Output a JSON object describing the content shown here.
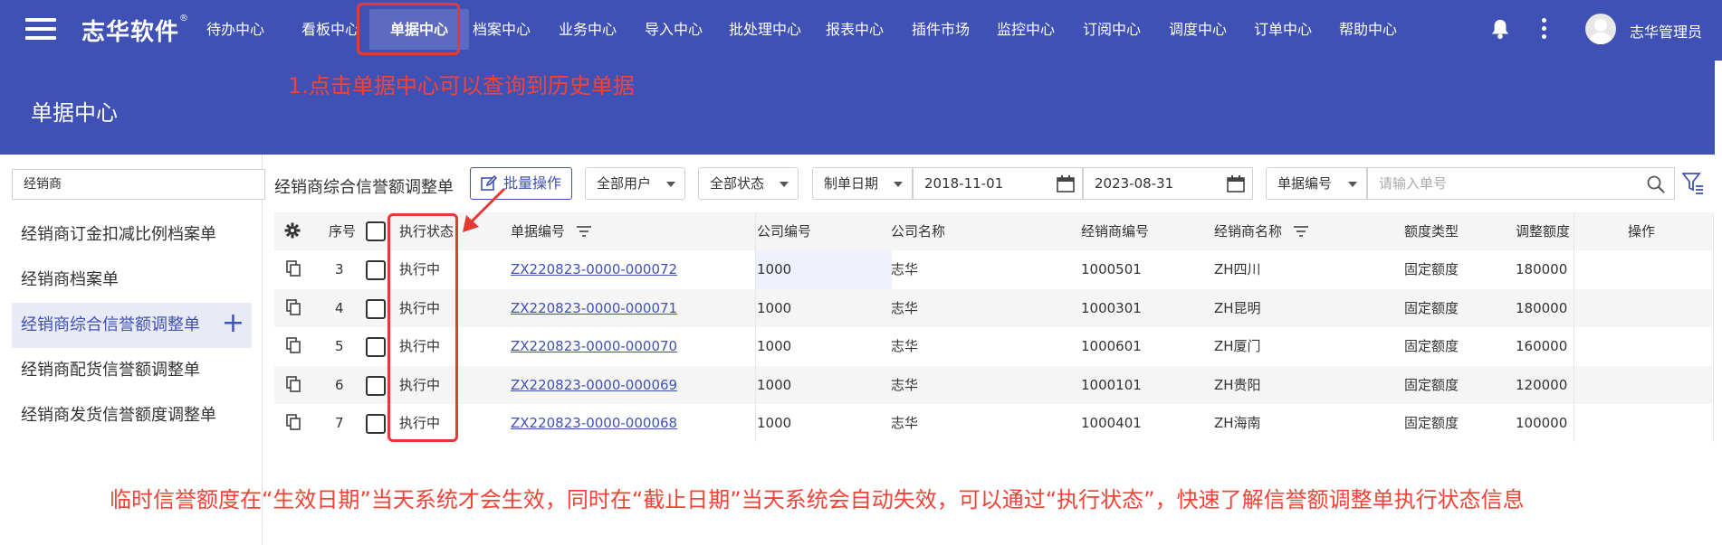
{
  "app": {
    "brand": "志华软件",
    "brand_mark": "®",
    "user_name": "志华管理员"
  },
  "nav": {
    "items": [
      "待办中心",
      "看板中心",
      "单据中心",
      "档案中心",
      "业务中心",
      "导入中心",
      "批处理中心",
      "报表中心",
      "插件市场",
      "监控中心",
      "订阅中心",
      "调度中心",
      "订单中心",
      "帮助中心"
    ],
    "active_index": 2
  },
  "page": {
    "title": "单据中心"
  },
  "annotations": {
    "tip1": "1.点击单据中心可以查询到历史单据",
    "tip2": "临时信誉额度在“生效日期”当天系统才会生效，同时在“截止日期”当天系统会自动失效，可以通过“执行状态”，快速了解信誉额调整单执行状态信息",
    "highlight_color": "#e53935"
  },
  "sidebar": {
    "search_value": "经销商",
    "items": [
      "经销商订金扣减比例档案单",
      "经销商档案单",
      "经销商综合信誉额调整单",
      "经销商配货信誉额调整单",
      "经销商发货信誉额度调整单"
    ],
    "active_index": 2,
    "add_label": "+"
  },
  "toolbar": {
    "title": "经销商综合信誉额调整单",
    "batch_label": "批量操作",
    "user_filter": "全部用户",
    "status_filter": "全部状态",
    "date_field": "制单日期",
    "date_from": "2018-11-01",
    "date_to": "2023-08-31",
    "search_field": "单据编号",
    "search_placeholder": "请输入单号"
  },
  "table": {
    "headers": {
      "seq": "序号",
      "status": "执行状态",
      "doc_no": "单据编号",
      "company_code": "公司编号",
      "company_name": "公司名称",
      "dealer_code": "经销商编号",
      "dealer_name": "经销商名称",
      "quota_type": "额度类型",
      "adjust_amount": "调整额度",
      "actions": "操作"
    },
    "rows": [
      {
        "seq": "3",
        "status": "执行中",
        "doc_no": "ZX220823-0000-000072",
        "company_code": "1000",
        "company_name": "志华",
        "dealer_code": "1000501",
        "dealer_name": "ZH四川",
        "quota_type": "固定额度",
        "adjust_amount": "180000"
      },
      {
        "seq": "4",
        "status": "执行中",
        "doc_no": "ZX220823-0000-000071",
        "company_code": "1000",
        "company_name": "志华",
        "dealer_code": "1000301",
        "dealer_name": "ZH昆明",
        "quota_type": "固定额度",
        "adjust_amount": "180000"
      },
      {
        "seq": "5",
        "status": "执行中",
        "doc_no": "ZX220823-0000-000070",
        "company_code": "1000",
        "company_name": "志华",
        "dealer_code": "1000601",
        "dealer_name": "ZH厦门",
        "quota_type": "固定额度",
        "adjust_amount": "160000"
      },
      {
        "seq": "6",
        "status": "执行中",
        "doc_no": "ZX220823-0000-000069",
        "company_code": "1000",
        "company_name": "志华",
        "dealer_code": "1000101",
        "dealer_name": "ZH贵阳",
        "quota_type": "固定额度",
        "adjust_amount": "120000"
      },
      {
        "seq": "7",
        "status": "执行中",
        "doc_no": "ZX220823-0000-000068",
        "company_code": "1000",
        "company_name": "志华",
        "dealer_code": "1000401",
        "dealer_name": "ZH海南",
        "quota_type": "固定额度",
        "adjust_amount": "100000"
      }
    ]
  }
}
